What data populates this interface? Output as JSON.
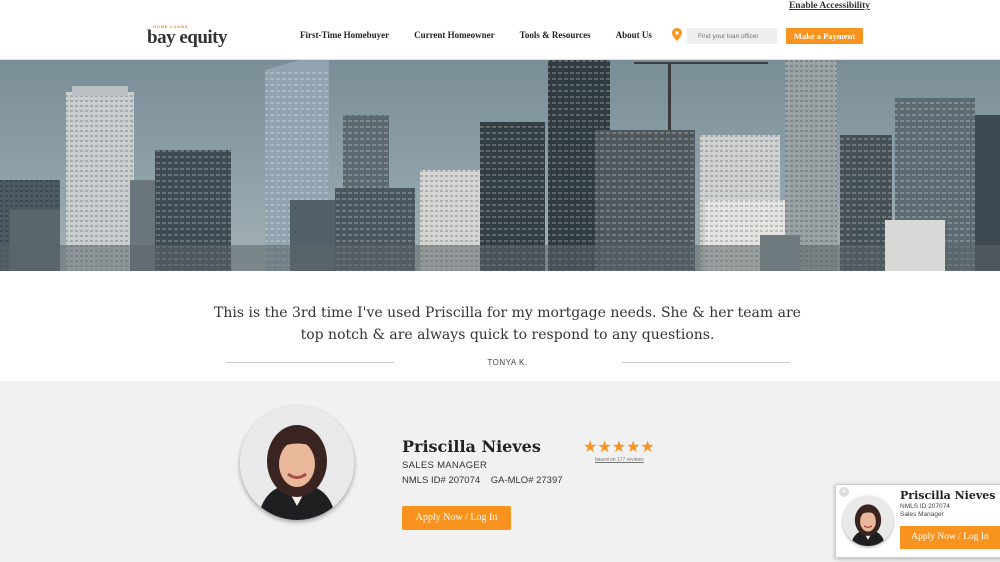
{
  "header": {
    "accessibility_link": "Enable Accessibility",
    "logo_tag": "HOME LOANS",
    "logo_text": "bay equity",
    "nav": [
      "First-Time Homebuyer",
      "Current Homeowner",
      "Tools & Resources",
      "About Us"
    ],
    "search_placeholder": "Find your loan officer",
    "payment_button": "Make a Payment",
    "accent_color": "#f7931e"
  },
  "testimonial": {
    "quote": "This is the 3rd time I've used Priscilla for my mortgage needs. She & her team are top notch & are always quick to respond to any questions.",
    "author": "TONYA K."
  },
  "profile": {
    "name": "Priscilla Nieves",
    "title": "SALES MANAGER",
    "nmls": "NMLS ID# 207074    GA-MLO# 27397",
    "rating_stars": 5,
    "stars": "★★★★★",
    "reviews_link": "based on 177 reviews",
    "apply_button": "Apply Now / Log In"
  },
  "floating_card": {
    "close": "x",
    "name": "Priscilla Nieves",
    "nmls": "NMLS ID 207074",
    "title": "Sales Manager",
    "button": "Apply Now / Log In"
  }
}
